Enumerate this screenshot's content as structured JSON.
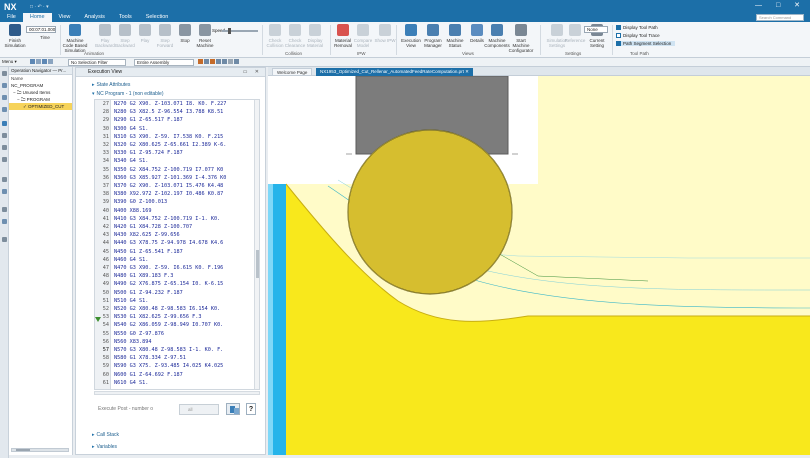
{
  "app": {
    "logo": "NX",
    "quick_access": "□ · ↶ · ▾",
    "window_controls": "— □ ✕",
    "command_finder_placeholder": "Search Command"
  },
  "menu": [
    "File",
    "Home",
    "View",
    "Analysis",
    "Tools",
    "Selection"
  ],
  "ribbon": {
    "time_value": "00:07:01.000",
    "buttons": [
      {
        "label": "Finish Simulation",
        "color": "#2f5b8a"
      },
      {
        "label": "Time",
        "color": "#6b7c8d"
      },
      {
        "label": "Machine Code Based Simulation",
        "color": "#3b7fb8"
      },
      {
        "label": "Play Backward",
        "color": "#b7c0c9"
      },
      {
        "label": "Step Backward",
        "color": "#b7c0c9"
      },
      {
        "label": "Play",
        "color": "#b7c0c9"
      },
      {
        "label": "Step Forward",
        "color": "#b7c0c9"
      },
      {
        "label": "Stop",
        "color": "#8a96a2"
      },
      {
        "label": "Reset Machine",
        "color": "#8a96a2"
      },
      {
        "label": "Check Collision",
        "color": "#c9d1d8"
      },
      {
        "label": "Check Clearance",
        "color": "#c9d1d8"
      },
      {
        "label": "Display Material",
        "color": "#c9d1d8"
      },
      {
        "label": "Material Removal",
        "color": "#d9534f"
      },
      {
        "label": "Compare Model",
        "color": "#c9d1d8"
      },
      {
        "label": "Show IPW",
        "color": "#c9d1d8"
      },
      {
        "label": "Execution View",
        "color": "#3b7fb8"
      },
      {
        "label": "Program Manager",
        "color": "#4a7fb0"
      },
      {
        "label": "Machine Status",
        "color": "#4a7fb0"
      },
      {
        "label": "Details",
        "color": "#5a8cc0"
      },
      {
        "label": "Machine Components",
        "color": "#4a7fb0"
      },
      {
        "label": "Start Machine Configurator",
        "color": "#7a8794"
      },
      {
        "label": "Simulation Settings",
        "color": "#c9d1d8"
      },
      {
        "label": "Reference",
        "color": "#c9d1d8"
      },
      {
        "label": "Current Setting",
        "color": "#7a8794"
      }
    ],
    "groups": [
      "Animation",
      "Collision",
      "IPW",
      "Views",
      "Settings",
      "Tool Path"
    ],
    "speed_label": "Speed",
    "none_value": "None",
    "toolpath_options": [
      "Display Tool Path",
      "Display Tool Trace",
      "Path Segment Selection"
    ]
  },
  "filterbar": {
    "menu_label": "Menu ▾",
    "selection_filter": "No Selection Filter",
    "assembly_scope": "Entire Assembly"
  },
  "navigator": {
    "title": "Operation Navigator — Pr...",
    "column": "Name",
    "items": [
      {
        "label": "NC_PROGRAM",
        "indent": 0
      },
      {
        "label": "− 🗀 Unused Items",
        "indent": 2
      },
      {
        "label": "− 🗀 PROGRAM",
        "indent": 6
      },
      {
        "label": "✓ OPTIMIZED_CUT",
        "indent": 12
      }
    ]
  },
  "execution": {
    "title": "Execution View",
    "state_attributes": "State Attributes",
    "nc_program": "NC Program - 1 (non editable)",
    "lines": [
      {
        "n": "27",
        "t": "N270 G2 X90. Z-103.071 I8. K0. F.227"
      },
      {
        "n": "28",
        "t": "N280 G3 X82.5 Z-96.554 I3.788 K8.51"
      },
      {
        "n": "29",
        "t": "N290 G1 Z-65.517 F.187"
      },
      {
        "n": "30",
        "t": "N300 G4 S1."
      },
      {
        "n": "31",
        "t": "N310 G3 X90. Z-59. I7.538 K0. F.215"
      },
      {
        "n": "32",
        "t": "N320 G2 X80.625 Z-65.661 I2.389 K-6."
      },
      {
        "n": "33",
        "t": "N330 G1 Z-95.724 F.187"
      },
      {
        "n": "34",
        "t": "N340 G4 S1."
      },
      {
        "n": "35",
        "t": "N350 G2 X84.752 Z-100.719 I7.077 K0"
      },
      {
        "n": "36",
        "t": "N360 G3 X85.927 Z-101.369 I-4.376 K0"
      },
      {
        "n": "37",
        "t": "N370 G2 X90. Z-103.071 I5.476 K4.48"
      },
      {
        "n": "38",
        "t": "N380 X92.972 Z-102.197 I0.486 K0.87"
      },
      {
        "n": "39",
        "t": "N390 G0 Z-100.013"
      },
      {
        "n": "40",
        "t": "N400 X88.169"
      },
      {
        "n": "41",
        "t": "N410 G3 X84.752 Z-100.719 I-1. K0."
      },
      {
        "n": "42",
        "t": "N420 G1 X84.728 Z-100.707"
      },
      {
        "n": "43",
        "t": "N430 X82.625 Z-99.656"
      },
      {
        "n": "44",
        "t": "N440 G3 X78.75 Z-94.978 I4.678 K4.6"
      },
      {
        "n": "45",
        "t": "N450 G1 Z-65.541 F.187"
      },
      {
        "n": "46",
        "t": "N460 G4 S1."
      },
      {
        "n": "47",
        "t": "N470 G3 X90. Z-59. I6.615 K0. F.196"
      },
      {
        "n": "48",
        "t": "N480 G1 X89.183 F.3"
      },
      {
        "n": "49",
        "t": "N490 G2 X76.875 Z-65.154 I0. K-6.15"
      },
      {
        "n": "50",
        "t": "N500 G1 Z-94.232 F.187"
      },
      {
        "n": "51",
        "t": "N510 G4 S1."
      },
      {
        "n": "52",
        "t": "N520 G2 X80.48 Z-98.583 I6.154 K0."
      },
      {
        "n": "53",
        "t": "N530 G1 X82.625 Z-99.656 F.3"
      },
      {
        "n": "54",
        "t": "N540 G2 X86.059 Z-98.949 I0.707 K0."
      },
      {
        "n": "55",
        "t": "N550 G0 Z-97.876"
      },
      {
        "n": "56",
        "t": "N560 X83.894"
      },
      {
        "n": "57",
        "t": "N570 G3 X80.48 Z-98.583 I-1. K0. F."
      },
      {
        "n": "58",
        "t": "N580 G1 X78.334 Z-97.51"
      },
      {
        "n": "59",
        "t": "N590 G3 X75. Z-93.485 I4.025 K4.025"
      },
      {
        "n": "60",
        "t": "N600 G1 Z-64.692 F.187"
      },
      {
        "n": "61",
        "t": "N610 G4 S1."
      }
    ],
    "execute_post_placeholder": "Execute Post - number o",
    "all_label": "all",
    "help_label": "?",
    "call_stack": "Call Stack",
    "variables": "Variables"
  },
  "graphics": {
    "tabs": [
      {
        "label": "Welcome Page",
        "active": false
      },
      {
        "label": "NX1953_Optimized_Cut_Rellenar_AutomatedFeedRateComputation.prt ✕",
        "active": true
      }
    ],
    "colors": {
      "part": "#fff06a",
      "part_dark": "#f6e40e",
      "tool": "#ddc534",
      "holder": "#7c7c7c",
      "stock_edge": "#25b4ea"
    }
  }
}
